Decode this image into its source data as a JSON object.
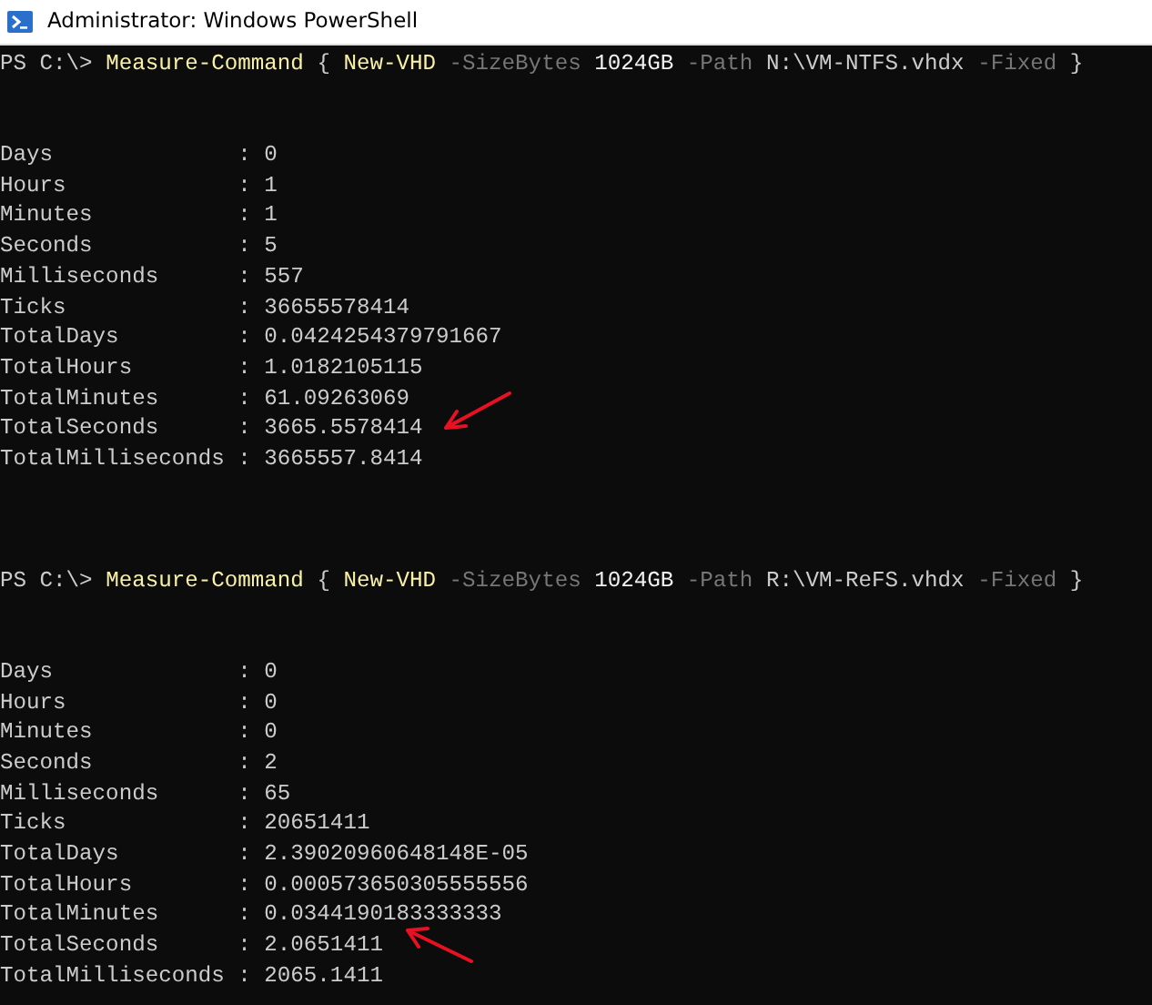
{
  "window": {
    "title": "Administrator: Windows PowerShell"
  },
  "sessions": [
    {
      "command": [
        {
          "kind": "prompt",
          "text": "PS C:\\>"
        },
        {
          "kind": "command",
          "text": "Measure-Command"
        },
        {
          "kind": "plain",
          "text": "{"
        },
        {
          "kind": "command",
          "text": "New-VHD"
        },
        {
          "kind": "parameter",
          "text": "-SizeBytes"
        },
        {
          "kind": "number",
          "text": "1024GB"
        },
        {
          "kind": "parameter",
          "text": "-Path"
        },
        {
          "kind": "plain",
          "text": "N:\\VM-NTFS.vhdx"
        },
        {
          "kind": "parameter",
          "text": "-Fixed"
        },
        {
          "kind": "plain",
          "text": "}"
        }
      ],
      "output": [
        {
          "text": "Days              : 0"
        },
        {
          "text": "Hours             : 1"
        },
        {
          "text": "Minutes           : 1"
        },
        {
          "text": "Seconds           : 5"
        },
        {
          "text": "Milliseconds      : 557"
        },
        {
          "text": "Ticks             : 36655578414"
        },
        {
          "text": "TotalDays         : 0.0424254379791667"
        },
        {
          "text": "TotalHours        : 1.0182105115"
        },
        {
          "text": "TotalMinutes      : 61.09263069"
        },
        {
          "text": "TotalSeconds      : 3665.5578414",
          "annotated": true
        },
        {
          "text": "TotalMilliseconds : 3665557.8414"
        }
      ]
    },
    {
      "command": [
        {
          "kind": "prompt",
          "text": "PS C:\\>"
        },
        {
          "kind": "command",
          "text": "Measure-Command"
        },
        {
          "kind": "plain",
          "text": "{"
        },
        {
          "kind": "command",
          "text": "New-VHD"
        },
        {
          "kind": "parameter",
          "text": "-SizeBytes"
        },
        {
          "kind": "number",
          "text": "1024GB"
        },
        {
          "kind": "parameter",
          "text": "-Path"
        },
        {
          "kind": "plain",
          "text": "R:\\VM-ReFS.vhdx"
        },
        {
          "kind": "parameter",
          "text": "-Fixed"
        },
        {
          "kind": "plain",
          "text": "}"
        }
      ],
      "output": [
        {
          "text": "Days              : 0"
        },
        {
          "text": "Hours             : 0"
        },
        {
          "text": "Minutes           : 0"
        },
        {
          "text": "Seconds           : 2"
        },
        {
          "text": "Milliseconds      : 65"
        },
        {
          "text": "Ticks             : 20651411"
        },
        {
          "text": "TotalDays         : 2.39020960648148E-05"
        },
        {
          "text": "TotalHours        : 0.000573650305555556"
        },
        {
          "text": "TotalMinutes      : 0.0344190183333333"
        },
        {
          "text": "TotalSeconds      : 2.0651411",
          "annotated": true
        },
        {
          "text": "TotalMilliseconds : 2065.1411"
        }
      ]
    }
  ]
}
